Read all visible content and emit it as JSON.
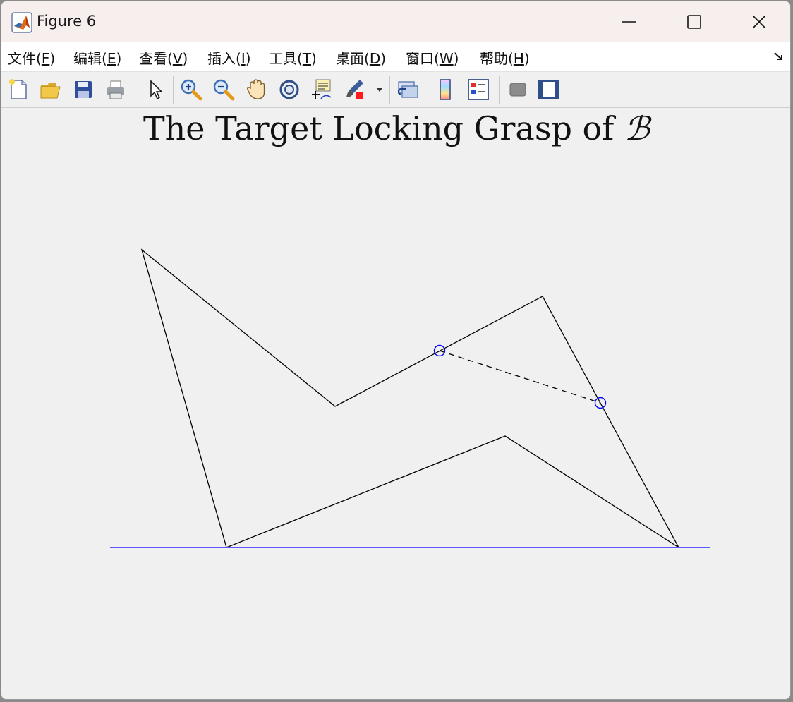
{
  "window": {
    "title": "Figure 6"
  },
  "menubar": {
    "items": [
      {
        "label_pre": "文件(",
        "mnemonic": "F",
        "label_post": ")"
      },
      {
        "label_pre": "编辑(",
        "mnemonic": "E",
        "label_post": ")"
      },
      {
        "label_pre": "查看(",
        "mnemonic": "V",
        "label_post": ")"
      },
      {
        "label_pre": "插入(",
        "mnemonic": "I",
        "label_post": ")"
      },
      {
        "label_pre": "工具(",
        "mnemonic": "T",
        "label_post": ")"
      },
      {
        "label_pre": "桌面(",
        "mnemonic": "D",
        "label_post": ")"
      },
      {
        "label_pre": "窗口(",
        "mnemonic": "W",
        "label_post": ")"
      },
      {
        "label_pre": "帮助(",
        "mnemonic": "H",
        "label_post": ")"
      }
    ]
  },
  "toolbar": {
    "icons": [
      "new-figure-icon",
      "open-file-icon",
      "save-icon",
      "print-icon",
      "pointer-icon",
      "zoom-in-icon",
      "zoom-out-icon",
      "pan-hand-icon",
      "rotate-3d-icon",
      "data-cursor-icon",
      "brush-icon",
      "link-plot-icon",
      "colorbar-icon",
      "legend-icon",
      "hide-plot-tools-icon",
      "show-plot-tools-icon"
    ]
  },
  "figure": {
    "title_text": "The Target Locking Grasp of ",
    "title_symbol": "ℬ",
    "colors": {
      "polygon": "#000000",
      "ground": "#0000ff",
      "markers": "#0000ff",
      "background": "#f0f0f0"
    }
  },
  "chart_data": {
    "type": "line",
    "title": "The Target Locking Grasp of ℬ",
    "axes_visible": false,
    "grid": false,
    "xlim": [
      0,
      850
    ],
    "ylim": [
      0,
      422
    ],
    "series": [
      {
        "kind": "polygon",
        "style": "solid",
        "color": "#000000",
        "x": [
          165,
          45,
          319,
          613,
          806,
          560,
          165
        ],
        "y": [
          0,
          422,
          200,
          356,
          0,
          158,
          0
        ]
      },
      {
        "kind": "ground-line",
        "style": "solid",
        "color": "#0000ff",
        "x": [
          0,
          850
        ],
        "y": [
          0,
          0
        ]
      },
      {
        "kind": "grasp-segment",
        "style": "dashed",
        "color": "#000000",
        "x": [
          467,
          695
        ],
        "y": [
          279,
          205
        ]
      },
      {
        "kind": "contact-markers",
        "style": "circle",
        "color": "#0000ff",
        "x": [
          467,
          695
        ],
        "y": [
          279,
          205
        ]
      }
    ]
  }
}
